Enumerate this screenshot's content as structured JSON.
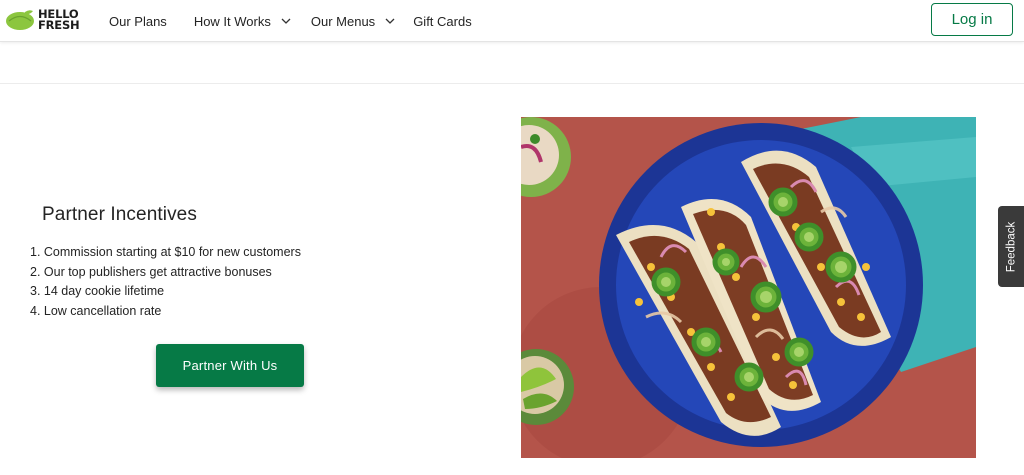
{
  "header": {
    "logo_line1": "HELLO",
    "logo_line2": "FRESH",
    "nav": {
      "plans": "Our Plans",
      "how_it_works": "How It Works",
      "menus": "Our Menus",
      "gift_cards": "Gift Cards"
    },
    "login_label": "Log in"
  },
  "main": {
    "title": "Partner Incentives",
    "incentives": [
      "1. Commission starting at $10 for new customers",
      "2. Our top publishers get attractive bonuses",
      "3. 14 day cookie lifetime",
      "4. Low cancellation rate"
    ],
    "partner_button": "Partner With Us"
  },
  "feedback_tab": "Feedback",
  "colors": {
    "brand_green": "#067a46",
    "logo_lime": "#8cc63f",
    "plate_blue": "#1f3fa8",
    "table_red": "#b4544a",
    "napkin_teal": "#3eb3b5"
  },
  "icons": {
    "logo": "lime-logo-icon",
    "dropdown": "chevron-down-icon"
  }
}
